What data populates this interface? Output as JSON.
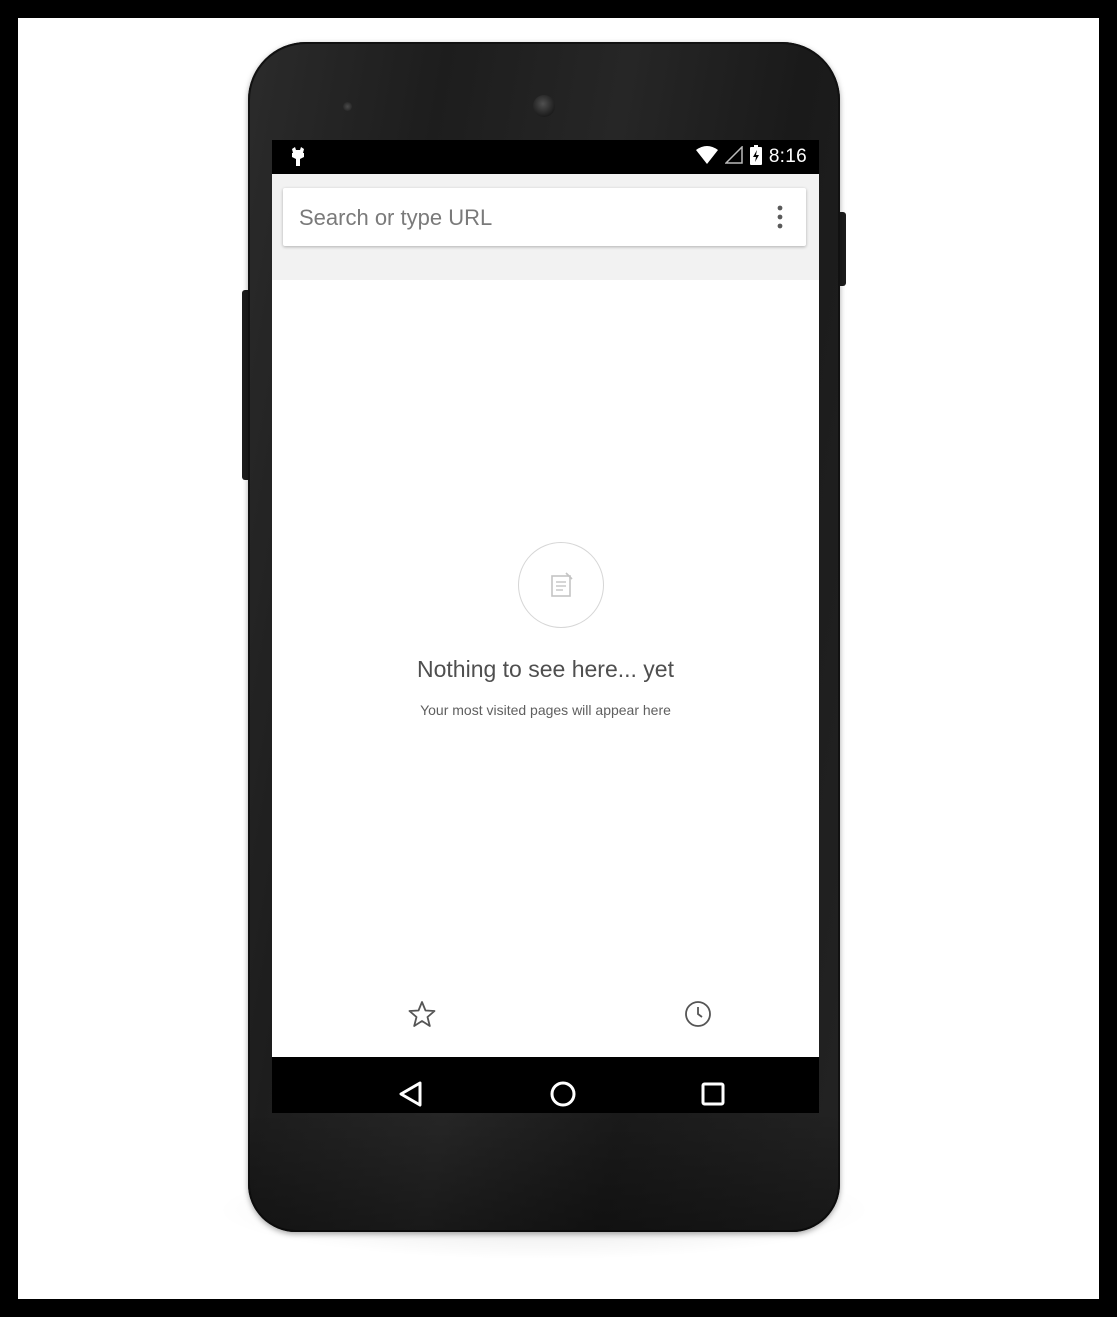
{
  "status_bar": {
    "time": "8:16",
    "icons": [
      "android-notification-icon",
      "wifi-icon",
      "cell-signal-icon",
      "battery-icon"
    ]
  },
  "omnibox": {
    "placeholder": "Search or type URL",
    "menu_icon": "more-vert-icon"
  },
  "empty_state": {
    "icon": "page-icon",
    "title": "Nothing to see here... yet",
    "subtitle": "Your most visited pages will appear here"
  },
  "bottom_toolbar": {
    "bookmarks_icon": "star-icon",
    "history_icon": "clock-icon"
  },
  "navigation": {
    "buttons": [
      "back-icon",
      "home-icon",
      "recents-icon"
    ]
  },
  "colors": {
    "device_body": "#232323",
    "status_bar": "#000000",
    "omnibox_background": "#f2f2f2",
    "screen_background": "#ffffff",
    "title_text": "#4f4f4f",
    "placeholder_text": "#7a7a7a"
  }
}
